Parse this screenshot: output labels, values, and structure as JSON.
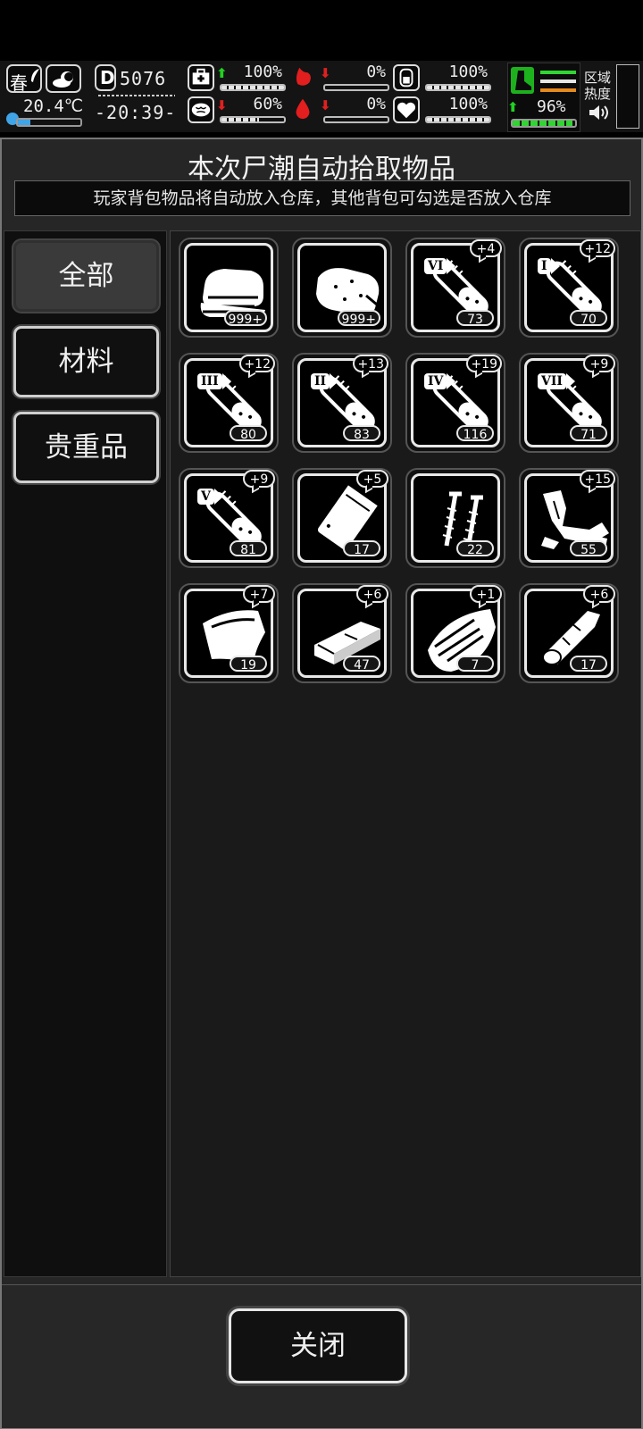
{
  "hud": {
    "season": "春",
    "temperature": "20.4℃",
    "temperature_level": 0.2,
    "day": "5076",
    "time": "-20:39-",
    "stats": [
      {
        "name": "health",
        "icon": "medkit-icon",
        "trend": "up",
        "value": "100%",
        "level": 1.0
      },
      {
        "name": "hunger",
        "icon": "stomach-icon",
        "trend": "down",
        "value": "0%",
        "level": 0.0
      },
      {
        "name": "energy",
        "icon": "battery-icon",
        "trend": "none",
        "value": "100%",
        "level": 1.0
      },
      {
        "name": "mood",
        "icon": "brain-icon",
        "trend": "down",
        "value": "60%",
        "level": 0.6
      },
      {
        "name": "thirst",
        "icon": "water-drop-icon",
        "trend": "down",
        "value": "0%",
        "level": 0.0
      },
      {
        "name": "heart",
        "icon": "heart-icon",
        "trend": "none",
        "value": "100%",
        "level": 1.0
      }
    ],
    "stamina": {
      "trend": "up",
      "value": "96%",
      "level": 0.96
    },
    "zone_heat_label": "区域\n热度"
  },
  "dialog": {
    "title": "本次尸潮自动拾取物品",
    "note": "玩家背包物品将自动放入仓库，其他背包可勾选是否放入仓库",
    "tabs": [
      {
        "label": "全部",
        "active": true
      },
      {
        "label": "材料",
        "active": false
      },
      {
        "label": "贵重品",
        "active": false
      }
    ],
    "items": [
      {
        "name": "cloth",
        "icon": "cloth-icon",
        "count": "999+",
        "bonus": ""
      },
      {
        "name": "raw-meat",
        "icon": "meat-icon",
        "count": "999+",
        "bonus": ""
      },
      {
        "name": "serum-vi",
        "icon": "test-tube-icon",
        "tier": "VI",
        "count": "73",
        "bonus": "+4"
      },
      {
        "name": "serum-i",
        "icon": "test-tube-icon",
        "tier": "I",
        "count": "70",
        "bonus": "+12"
      },
      {
        "name": "serum-iii",
        "icon": "test-tube-icon",
        "tier": "III",
        "count": "80",
        "bonus": "+12"
      },
      {
        "name": "serum-ii",
        "icon": "test-tube-icon",
        "tier": "II",
        "count": "83",
        "bonus": "+13"
      },
      {
        "name": "serum-iv",
        "icon": "test-tube-icon",
        "tier": "IV",
        "count": "116",
        "bonus": "+19"
      },
      {
        "name": "serum-vii",
        "icon": "test-tube-icon",
        "tier": "VII",
        "count": "71",
        "bonus": "+9"
      },
      {
        "name": "serum-v",
        "icon": "test-tube-icon",
        "tier": "V",
        "count": "81",
        "bonus": "+9"
      },
      {
        "name": "plastic-bag",
        "icon": "bag-icon",
        "count": "17",
        "bonus": "+5"
      },
      {
        "name": "nails",
        "icon": "nails-icon",
        "count": "22",
        "bonus": ""
      },
      {
        "name": "rags",
        "icon": "rags-icon",
        "count": "55",
        "bonus": "+15"
      },
      {
        "name": "leather",
        "icon": "leather-icon",
        "count": "19",
        "bonus": "+7"
      },
      {
        "name": "wood-plank",
        "icon": "plank-icon",
        "count": "47",
        "bonus": "+6"
      },
      {
        "name": "bark",
        "icon": "bark-icon",
        "count": "7",
        "bonus": "+1"
      },
      {
        "name": "log",
        "icon": "log-icon",
        "count": "17",
        "bonus": "+6"
      }
    ],
    "close_label": "关闭"
  }
}
